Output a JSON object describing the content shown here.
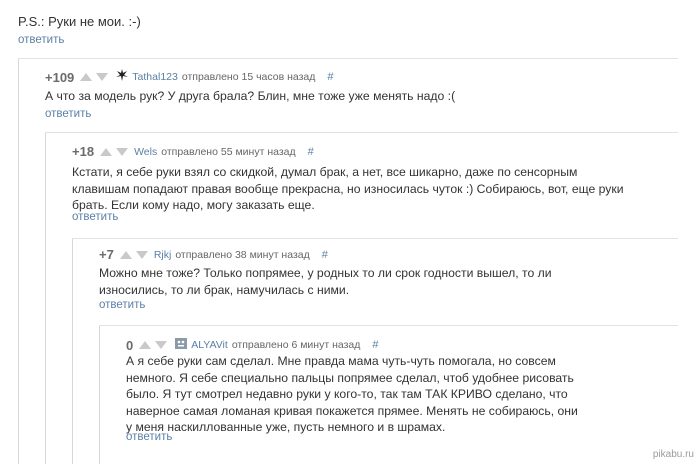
{
  "ps_line": "P.S.: Руки не мои. :-)",
  "reply_label": "ответить",
  "comments": [
    {
      "score": "+109",
      "username": "Tathal123",
      "posted": "отправлено 15 часов назад",
      "hash": "#",
      "avatar_icon": "black-cross-avatar-icon",
      "lines": [
        "А что за модель рук? У друга брала? Блин, мне тоже уже менять надо :("
      ]
    },
    {
      "score": "+18",
      "username": "Wels",
      "posted": "отправлено 55 минут назад",
      "hash": "#",
      "lines": [
        "Кстати, я себе руки взял со скидкой, думал брак, а нет, все шикарно, даже по сенсорным",
        "клавишам попадают правая вообще прекрасна, но износилась чуток :) Собираюсь, вот, еще руки",
        "брать. Если кому надо, могу заказать еще."
      ]
    },
    {
      "score": "+7",
      "username": "Rjkj",
      "posted": "отправлено 38 минут назад",
      "hash": "#",
      "lines": [
        "Можно мне тоже? Только попрямее, у родных то ли срок годности вышел, то ли",
        "износились, то ли брак, намучилась с ними."
      ]
    },
    {
      "score": "0",
      "username": "ALYAVit",
      "posted": "отправлено 6 минут назад",
      "hash": "#",
      "avatar_icon": "grey-face-avatar-icon",
      "lines": [
        "А я себе руки сам сделал. Мне правда мама чуть-чуть помогала, но совсем",
        "немного. Я себе специально пальцы попрямее сделал, чтоб удобнее рисовать",
        "было. Я тут смотрел недавно руки у кого-то, так там ТАК КРИВО сделано, что",
        "наверное самая ломаная кривая покажется прямее. Менять не собираюсь, они",
        "у меня наскиллованные уже, пусть немного и в шрамах."
      ]
    }
  ],
  "watermark": "pikabu.ru",
  "colors": {
    "link": "#5b7fa6",
    "text": "#333333",
    "score": "#6b6b6b",
    "arrow": "#c9c9c9",
    "thread_line": "#d6d6d6"
  }
}
